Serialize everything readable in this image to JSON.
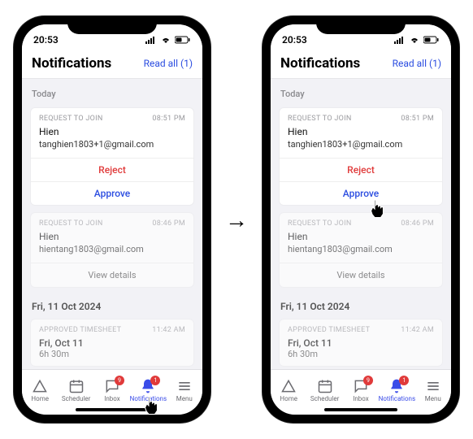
{
  "status": {
    "time": "20:53"
  },
  "header": {
    "title": "Notifications",
    "read_all": "Read all (1)"
  },
  "sections": {
    "today_label": "Today",
    "date_label": "Fri, 11 Oct 2024"
  },
  "card1": {
    "type": "REQUEST TO JOIN",
    "time": "08:51 PM",
    "name": "Hien",
    "email": "tanghien1803+1@gmail.com",
    "reject": "Reject",
    "approve": "Approve"
  },
  "card2": {
    "type": "REQUEST TO JOIN",
    "time": "08:46 PM",
    "name": "Hien",
    "email": "hientang1803@gmail.com",
    "view_details": "View details"
  },
  "card3": {
    "type": "APPROVED TIMESHEET",
    "time": "11:42 AM",
    "date": "Fri, Oct 11",
    "duration": "6h 30m"
  },
  "tabs": {
    "home": "Home",
    "scheduler": "Scheduler",
    "inbox": "Inbox",
    "notifications": "Notifications",
    "menu": "Menu",
    "inbox_badge": "9",
    "notif_badge": "1"
  }
}
